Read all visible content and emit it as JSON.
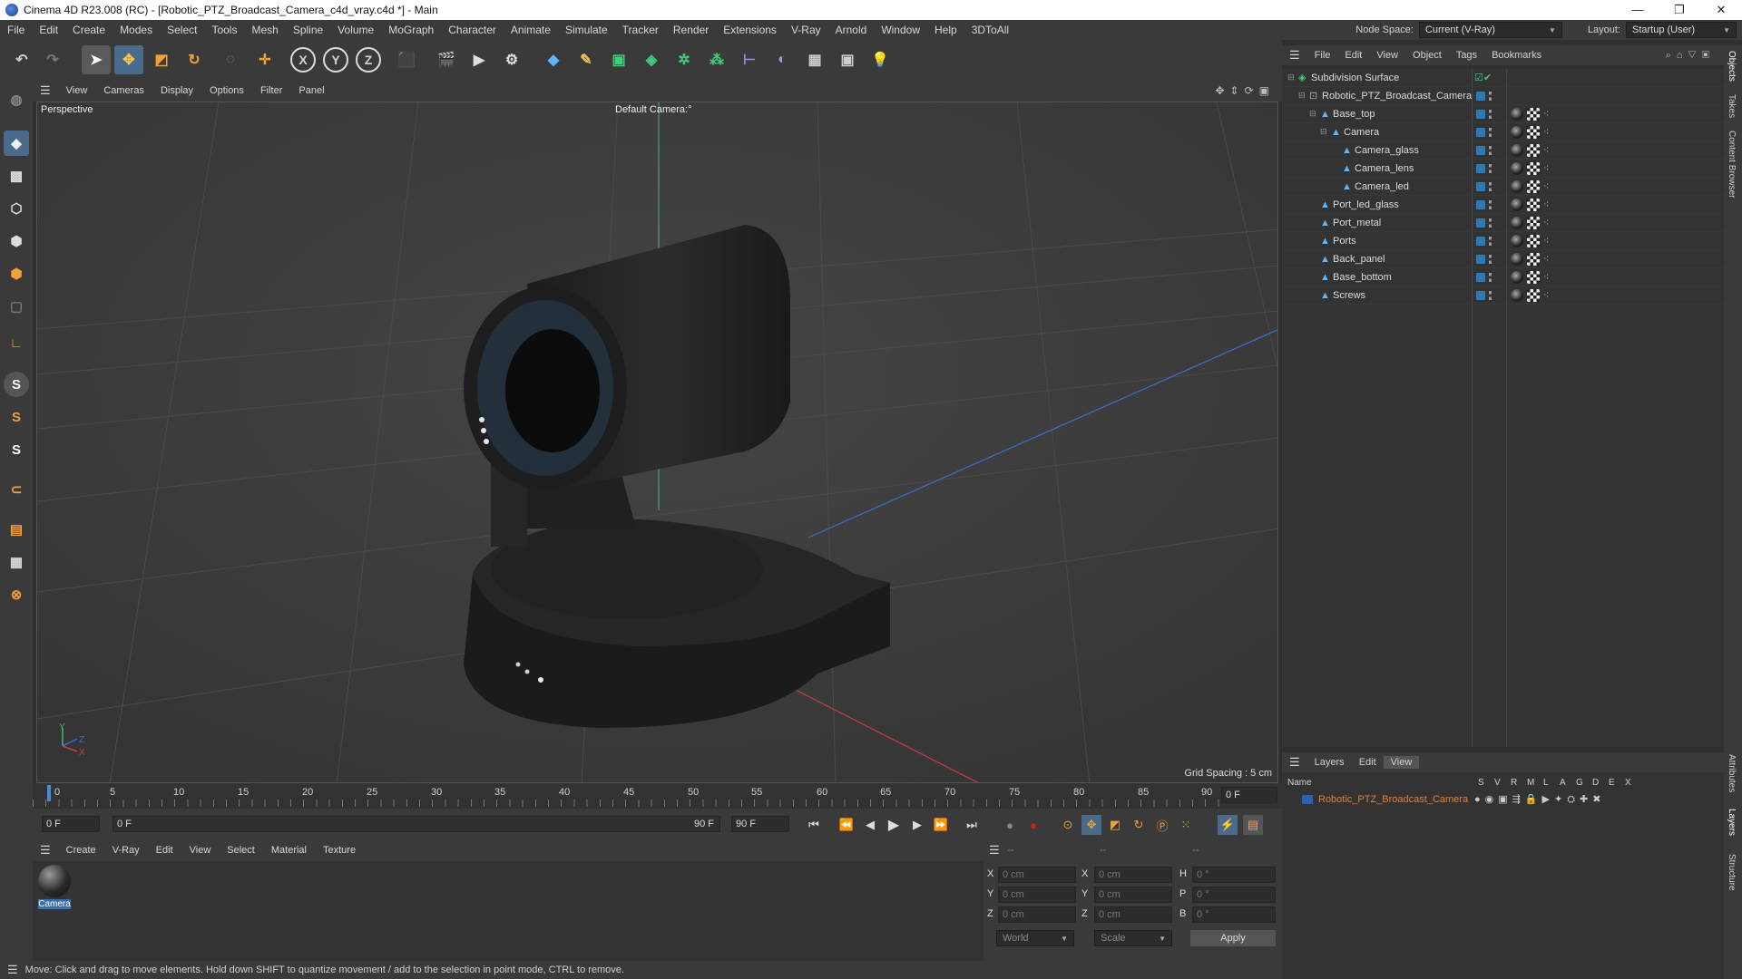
{
  "window": {
    "title": "Cinema 4D R23.008 (RC) - [Robotic_PTZ_Broadcast_Camera_c4d_vray.c4d *] - Main",
    "minimize": "—",
    "maximize": "❐",
    "close": "✕"
  },
  "menubar": {
    "items": [
      "File",
      "Edit",
      "Create",
      "Modes",
      "Select",
      "Tools",
      "Mesh",
      "Spline",
      "Volume",
      "MoGraph",
      "Character",
      "Animate",
      "Simulate",
      "Tracker",
      "Render",
      "Extensions",
      "V-Ray",
      "Arnold",
      "Window",
      "Help",
      "3DToAll"
    ],
    "node_space_label": "Node Space:",
    "node_space_value": "Current (V-Ray)",
    "layout_label": "Layout:",
    "layout_value": "Startup (User)"
  },
  "viewport": {
    "menu": [
      "View",
      "Cameras",
      "Display",
      "Options",
      "Filter",
      "Panel"
    ],
    "view_name": "Perspective",
    "camera_name": "Default Camera",
    "camera_suffix": ":°",
    "grid_spacing": "Grid Spacing : 5 cm",
    "axis_y": "Y",
    "axis_z": "Z",
    "axis_x": "X"
  },
  "timeline": {
    "ticks": [
      "0",
      "5",
      "10",
      "15",
      "20",
      "25",
      "30",
      "35",
      "40",
      "45",
      "50",
      "55",
      "60",
      "65",
      "70",
      "75",
      "80",
      "85",
      "90"
    ],
    "current_frame": "0 F",
    "start_frame": "0 F",
    "range_start": "0 F",
    "range_end": "90 F",
    "end_frame": "90 F"
  },
  "material_manager": {
    "menu": [
      "Create",
      "V-Ray",
      "Edit",
      "View",
      "Select",
      "Material",
      "Texture"
    ],
    "materials": [
      {
        "name": "Camera"
      }
    ]
  },
  "coordinates": {
    "headers": [
      "--",
      "--",
      "--"
    ],
    "rows": [
      {
        "l1": "X",
        "v1": "0 cm",
        "l2": "X",
        "v2": "0 cm",
        "l3": "H",
        "v3": "0 °"
      },
      {
        "l1": "Y",
        "v1": "0 cm",
        "l2": "Y",
        "v2": "0 cm",
        "l3": "P",
        "v3": "0 °"
      },
      {
        "l1": "Z",
        "v1": "0 cm",
        "l2": "Z",
        "v2": "0 cm",
        "l3": "B",
        "v3": "0 °"
      }
    ],
    "mode_world": "World",
    "mode_scale": "Scale",
    "apply": "Apply"
  },
  "status": "Move: Click and drag to move elements. Hold down SHIFT to quantize movement / add to the selection in point mode, CTRL to remove.",
  "object_manager": {
    "menu": [
      "File",
      "Edit",
      "View",
      "Object",
      "Tags",
      "Bookmarks"
    ],
    "objects": [
      {
        "name": "Subdivision Surface",
        "depth": 0,
        "icon": "subdivision-icon"
      },
      {
        "name": "Robotic_PTZ_Broadcast_Camera",
        "depth": 1,
        "icon": "null-icon"
      },
      {
        "name": "Base_top",
        "depth": 2,
        "icon": "polygon-icon"
      },
      {
        "name": "Camera",
        "depth": 3,
        "icon": "polygon-icon"
      },
      {
        "name": "Camera_glass",
        "depth": 4,
        "icon": "polygon-icon"
      },
      {
        "name": "Camera_lens",
        "depth": 4,
        "icon": "polygon-icon"
      },
      {
        "name": "Camera_led",
        "depth": 4,
        "icon": "polygon-icon"
      },
      {
        "name": "Port_led_glass",
        "depth": 2,
        "icon": "polygon-icon"
      },
      {
        "name": "Port_metal",
        "depth": 2,
        "icon": "polygon-icon"
      },
      {
        "name": "Ports",
        "depth": 2,
        "icon": "polygon-icon"
      },
      {
        "name": "Back_panel",
        "depth": 2,
        "icon": "polygon-icon"
      },
      {
        "name": "Base_bottom",
        "depth": 2,
        "icon": "polygon-icon"
      },
      {
        "name": "Screws",
        "depth": 2,
        "icon": "polygon-icon"
      }
    ]
  },
  "layer_manager": {
    "menu": [
      "Layers",
      "Edit",
      "View"
    ],
    "columns": [
      "Name",
      "S",
      "V",
      "R",
      "M",
      "L",
      "A",
      "G",
      "D",
      "E",
      "X"
    ],
    "layers": [
      {
        "name": "Robotic_PTZ_Broadcast_Camera",
        "color": "#2b5fb8"
      }
    ]
  },
  "right_tabs": [
    "Objects",
    "Takes",
    "Content Browser",
    "Attributes",
    "Layers",
    "Structure"
  ],
  "colors": {
    "accent": "#3c8ee0",
    "layer_text": "#e0803a",
    "record": "#d02020"
  }
}
